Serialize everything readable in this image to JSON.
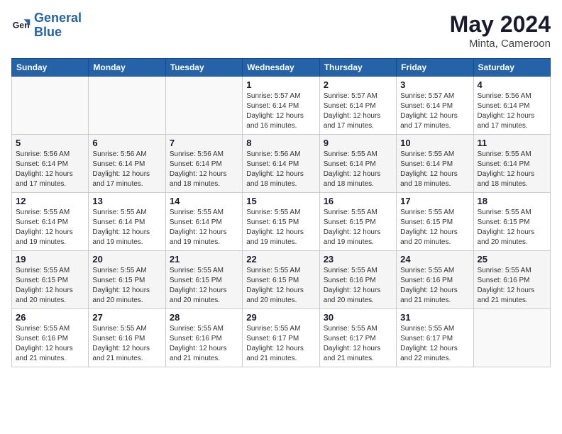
{
  "header": {
    "logo_general": "General",
    "logo_blue": "Blue",
    "title": "May 2024",
    "subtitle": "Minta, Cameroon"
  },
  "calendar": {
    "days_of_week": [
      "Sunday",
      "Monday",
      "Tuesday",
      "Wednesday",
      "Thursday",
      "Friday",
      "Saturday"
    ],
    "weeks": [
      [
        {
          "day": "",
          "info": ""
        },
        {
          "day": "",
          "info": ""
        },
        {
          "day": "",
          "info": ""
        },
        {
          "day": "1",
          "info": "Sunrise: 5:57 AM\nSunset: 6:14 PM\nDaylight: 12 hours\nand 16 minutes."
        },
        {
          "day": "2",
          "info": "Sunrise: 5:57 AM\nSunset: 6:14 PM\nDaylight: 12 hours\nand 17 minutes."
        },
        {
          "day": "3",
          "info": "Sunrise: 5:57 AM\nSunset: 6:14 PM\nDaylight: 12 hours\nand 17 minutes."
        },
        {
          "day": "4",
          "info": "Sunrise: 5:56 AM\nSunset: 6:14 PM\nDaylight: 12 hours\nand 17 minutes."
        }
      ],
      [
        {
          "day": "5",
          "info": "Sunrise: 5:56 AM\nSunset: 6:14 PM\nDaylight: 12 hours\nand 17 minutes."
        },
        {
          "day": "6",
          "info": "Sunrise: 5:56 AM\nSunset: 6:14 PM\nDaylight: 12 hours\nand 17 minutes."
        },
        {
          "day": "7",
          "info": "Sunrise: 5:56 AM\nSunset: 6:14 PM\nDaylight: 12 hours\nand 18 minutes."
        },
        {
          "day": "8",
          "info": "Sunrise: 5:56 AM\nSunset: 6:14 PM\nDaylight: 12 hours\nand 18 minutes."
        },
        {
          "day": "9",
          "info": "Sunrise: 5:55 AM\nSunset: 6:14 PM\nDaylight: 12 hours\nand 18 minutes."
        },
        {
          "day": "10",
          "info": "Sunrise: 5:55 AM\nSunset: 6:14 PM\nDaylight: 12 hours\nand 18 minutes."
        },
        {
          "day": "11",
          "info": "Sunrise: 5:55 AM\nSunset: 6:14 PM\nDaylight: 12 hours\nand 18 minutes."
        }
      ],
      [
        {
          "day": "12",
          "info": "Sunrise: 5:55 AM\nSunset: 6:14 PM\nDaylight: 12 hours\nand 19 minutes."
        },
        {
          "day": "13",
          "info": "Sunrise: 5:55 AM\nSunset: 6:14 PM\nDaylight: 12 hours\nand 19 minutes."
        },
        {
          "day": "14",
          "info": "Sunrise: 5:55 AM\nSunset: 6:14 PM\nDaylight: 12 hours\nand 19 minutes."
        },
        {
          "day": "15",
          "info": "Sunrise: 5:55 AM\nSunset: 6:15 PM\nDaylight: 12 hours\nand 19 minutes."
        },
        {
          "day": "16",
          "info": "Sunrise: 5:55 AM\nSunset: 6:15 PM\nDaylight: 12 hours\nand 19 minutes."
        },
        {
          "day": "17",
          "info": "Sunrise: 5:55 AM\nSunset: 6:15 PM\nDaylight: 12 hours\nand 20 minutes."
        },
        {
          "day": "18",
          "info": "Sunrise: 5:55 AM\nSunset: 6:15 PM\nDaylight: 12 hours\nand 20 minutes."
        }
      ],
      [
        {
          "day": "19",
          "info": "Sunrise: 5:55 AM\nSunset: 6:15 PM\nDaylight: 12 hours\nand 20 minutes."
        },
        {
          "day": "20",
          "info": "Sunrise: 5:55 AM\nSunset: 6:15 PM\nDaylight: 12 hours\nand 20 minutes."
        },
        {
          "day": "21",
          "info": "Sunrise: 5:55 AM\nSunset: 6:15 PM\nDaylight: 12 hours\nand 20 minutes."
        },
        {
          "day": "22",
          "info": "Sunrise: 5:55 AM\nSunset: 6:15 PM\nDaylight: 12 hours\nand 20 minutes."
        },
        {
          "day": "23",
          "info": "Sunrise: 5:55 AM\nSunset: 6:16 PM\nDaylight: 12 hours\nand 20 minutes."
        },
        {
          "day": "24",
          "info": "Sunrise: 5:55 AM\nSunset: 6:16 PM\nDaylight: 12 hours\nand 21 minutes."
        },
        {
          "day": "25",
          "info": "Sunrise: 5:55 AM\nSunset: 6:16 PM\nDaylight: 12 hours\nand 21 minutes."
        }
      ],
      [
        {
          "day": "26",
          "info": "Sunrise: 5:55 AM\nSunset: 6:16 PM\nDaylight: 12 hours\nand 21 minutes."
        },
        {
          "day": "27",
          "info": "Sunrise: 5:55 AM\nSunset: 6:16 PM\nDaylight: 12 hours\nand 21 minutes."
        },
        {
          "day": "28",
          "info": "Sunrise: 5:55 AM\nSunset: 6:16 PM\nDaylight: 12 hours\nand 21 minutes."
        },
        {
          "day": "29",
          "info": "Sunrise: 5:55 AM\nSunset: 6:17 PM\nDaylight: 12 hours\nand 21 minutes."
        },
        {
          "day": "30",
          "info": "Sunrise: 5:55 AM\nSunset: 6:17 PM\nDaylight: 12 hours\nand 21 minutes."
        },
        {
          "day": "31",
          "info": "Sunrise: 5:55 AM\nSunset: 6:17 PM\nDaylight: 12 hours\nand 22 minutes."
        },
        {
          "day": "",
          "info": ""
        }
      ]
    ]
  }
}
